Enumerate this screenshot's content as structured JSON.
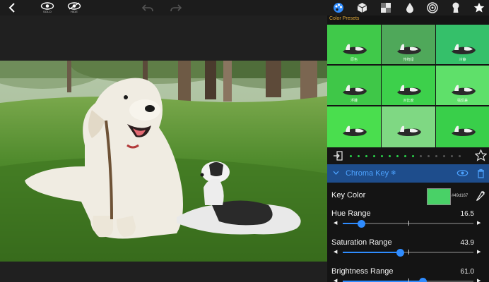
{
  "toolbar": {
    "solo_label": "SOLO",
    "hide_label": "HIDE",
    "icons": [
      "back-icon",
      "solo-eye-icon",
      "hide-eye-icon",
      "undo-icon",
      "redo-icon",
      "palette-icon",
      "cube-icon",
      "checker-icon",
      "drop-icon",
      "spiral-icon",
      "keyhole-icon",
      "star-icon"
    ]
  },
  "presets": {
    "title": "Color Presets",
    "items": [
      {
        "label": "原色",
        "color": "#40c94a"
      },
      {
        "label": "传统绿",
        "color": "#4fa85a"
      },
      {
        "label": "冷静",
        "color": "#35c06a"
      },
      {
        "label": "浮雕",
        "color": "#3fc748"
      },
      {
        "label": "对比度",
        "color": "#3dd04b"
      },
      {
        "label": "强反差",
        "color": "#5fe06a"
      },
      {
        "label": "",
        "color": "#4ade4e"
      },
      {
        "label": "",
        "color": "#7fd883"
      },
      {
        "label": "",
        "color": "#39cf4a"
      }
    ]
  },
  "layer": {
    "title": "Chroma Key",
    "key_color_label": "Key Color",
    "key_color_hex": "#49d167",
    "key_color": "#49d167",
    "accent": "#4da3ff",
    "header_bg": "#1e4d8c"
  },
  "sliders": [
    {
      "label": "Hue Range",
      "value": "16.5",
      "fraction": 0.14
    },
    {
      "label": "Saturation Range",
      "value": "43.9",
      "fraction": 0.44
    },
    {
      "label": "Brightness Range",
      "value": "61.0",
      "fraction": 0.61
    }
  ]
}
